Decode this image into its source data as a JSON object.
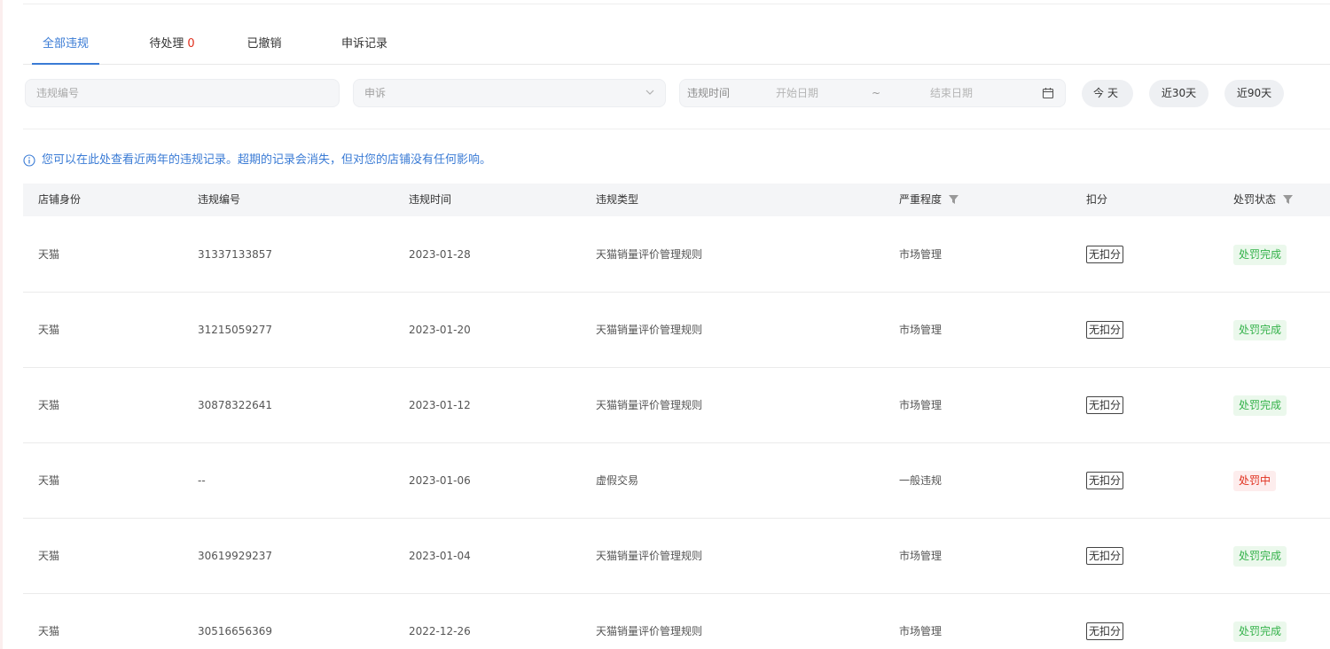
{
  "tabs": [
    {
      "label": "全部违规",
      "active": true
    },
    {
      "label": "待处理",
      "count": "0"
    },
    {
      "label": "已撤销"
    },
    {
      "label": "申诉记录"
    }
  ],
  "filters": {
    "violation_id_placeholder": "违规编号",
    "appeal_select_value": "申诉",
    "date_label": "违规时间",
    "date_start_placeholder": "开始日期",
    "date_separator": "~",
    "date_end_placeholder": "结束日期",
    "quick_ranges": [
      "今天",
      "近30天",
      "近90天"
    ]
  },
  "notice": {
    "icon": "info-icon",
    "text": "您可以在此处查看近两年的违规记录。超期的记录会消失，但对您的店铺没有任何影响。"
  },
  "table": {
    "columns": [
      "店铺身份",
      "违规编号",
      "违规时间",
      "违规类型",
      "严重程度",
      "扣分",
      "处罚状态"
    ],
    "rows": [
      {
        "shop": "天猫",
        "id": "31337133857",
        "date": "2023-01-28",
        "type": "天猫销量评价管理规则",
        "severity": "市场管理",
        "score": "无扣分",
        "status": "处罚完成",
        "status_kind": "done"
      },
      {
        "shop": "天猫",
        "id": "31215059277",
        "date": "2023-01-20",
        "type": "天猫销量评价管理规则",
        "severity": "市场管理",
        "score": "无扣分",
        "status": "处罚完成",
        "status_kind": "done"
      },
      {
        "shop": "天猫",
        "id": "30878322641",
        "date": "2023-01-12",
        "type": "天猫销量评价管理规则",
        "severity": "市场管理",
        "score": "无扣分",
        "status": "处罚完成",
        "status_kind": "done"
      },
      {
        "shop": "天猫",
        "id": "--",
        "date": "2023-01-06",
        "type": "虚假交易",
        "severity": "一般违规",
        "score": "无扣分",
        "status": "处罚中",
        "status_kind": "doing"
      },
      {
        "shop": "天猫",
        "id": "30619929237",
        "date": "2023-01-04",
        "type": "天猫销量评价管理规则",
        "severity": "市场管理",
        "score": "无扣分",
        "status": "处罚完成",
        "status_kind": "done"
      },
      {
        "shop": "天猫",
        "id": "30516656369",
        "date": "2022-12-26",
        "type": "天猫销量评价管理规则",
        "severity": "市场管理",
        "score": "无扣分",
        "status": "处罚完成",
        "status_kind": "done"
      }
    ]
  },
  "colors": {
    "accent": "#3a7bd5",
    "danger": "#e0301e",
    "success": "#34b24a"
  }
}
